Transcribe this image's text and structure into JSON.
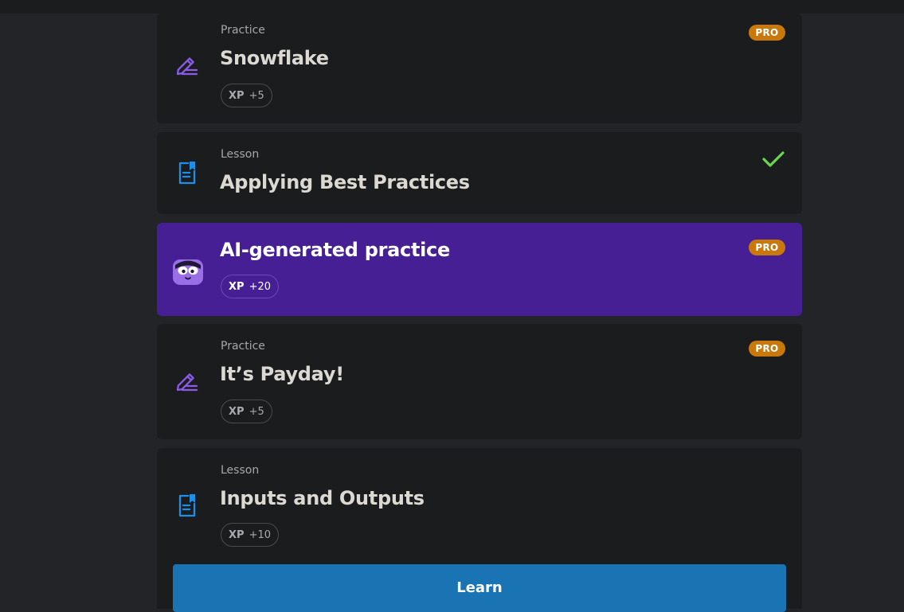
{
  "cards": [
    {
      "type_label": "Practice",
      "title": "Snowflake",
      "xp_label": "XP",
      "xp_value": "+5",
      "badge": "PRO",
      "icon": "pencil-icon"
    },
    {
      "type_label": "Lesson",
      "title": "Applying Best Practices",
      "status": "completed",
      "icon": "lesson-icon"
    },
    {
      "title": "AI-generated practice",
      "xp_label": "XP",
      "xp_value": "+20",
      "badge": "PRO",
      "icon": "ai-mascot-icon"
    },
    {
      "type_label": "Practice",
      "title": "It’s Payday!",
      "xp_label": "XP",
      "xp_value": "+5",
      "badge": "PRO",
      "icon": "pencil-icon"
    },
    {
      "type_label": "Lesson",
      "title": "Inputs and Outputs",
      "xp_label": "XP",
      "xp_value": "+10",
      "icon": "lesson-icon"
    }
  ],
  "learn_button": {
    "label": "Learn"
  },
  "colors": {
    "background": "#232427",
    "card": "#1b1c1e",
    "ai_card": "#461f95",
    "pro_badge": "#c9790c",
    "check": "#6bd64c",
    "learn_button": "#1a73b3",
    "practice_icon": "#8b5be8",
    "lesson_icon": "#1c8fe8"
  }
}
